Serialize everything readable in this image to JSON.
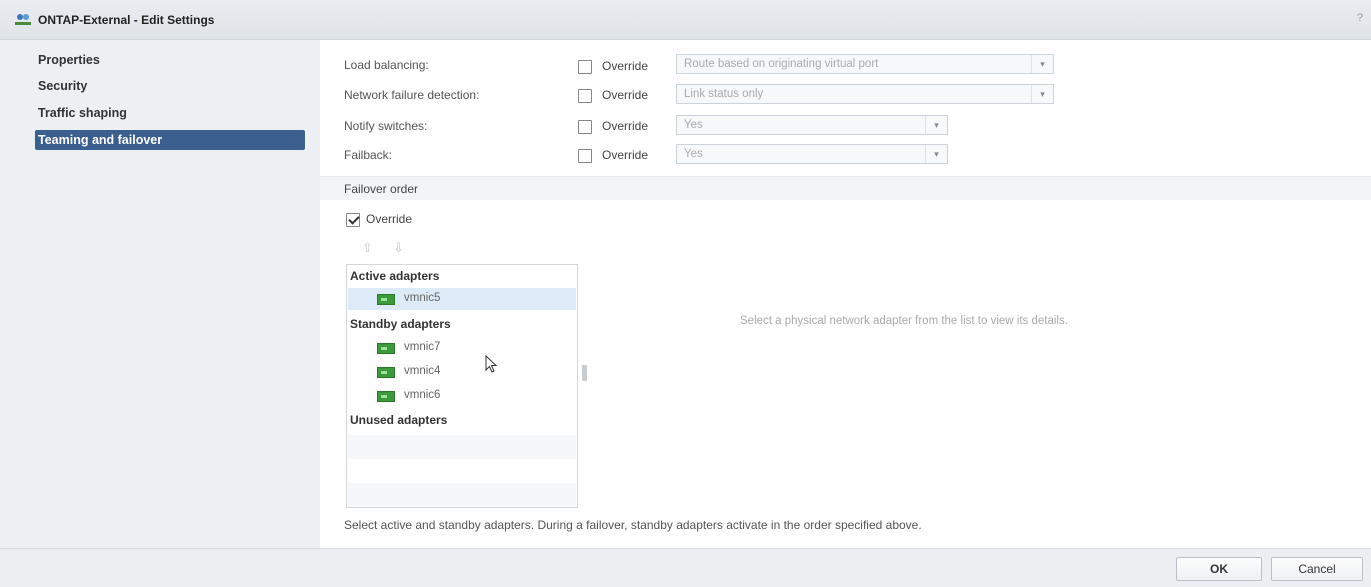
{
  "window": {
    "title": "ONTAP-External - Edit Settings",
    "help": "?"
  },
  "sidebar": {
    "items": [
      {
        "label": "Properties"
      },
      {
        "label": "Security"
      },
      {
        "label": "Traffic shaping"
      },
      {
        "label": "Teaming and failover",
        "selected": true
      }
    ]
  },
  "settings": [
    {
      "label": "Load balancing:",
      "override": "Override",
      "value": "Route based on originating virtual port"
    },
    {
      "label": "Network failure detection:",
      "override": "Override",
      "value": "Link status only"
    },
    {
      "label": "Notify switches:",
      "override": "Override",
      "value": "Yes"
    },
    {
      "label": "Failback:",
      "override": "Override",
      "value": "Yes"
    }
  ],
  "failover": {
    "title": "Failover order",
    "override_label": "Override",
    "override_checked": true,
    "groups": {
      "active": "Active adapters",
      "standby": "Standby adapters",
      "unused": "Unused adapters"
    },
    "active_adapters": [
      "vmnic5"
    ],
    "standby_adapters": [
      "vmnic7",
      "vmnic4",
      "vmnic6"
    ],
    "hint": "Select a physical network adapter from the list to view its details.",
    "footer": "Select active and standby adapters. During a failover, standby adapters activate in the order specified above."
  },
  "buttons": {
    "ok": "OK",
    "cancel": "Cancel"
  },
  "icons": {
    "up": "move-up-icon",
    "down": "move-down-icon",
    "nic": "network-adapter-icon"
  }
}
